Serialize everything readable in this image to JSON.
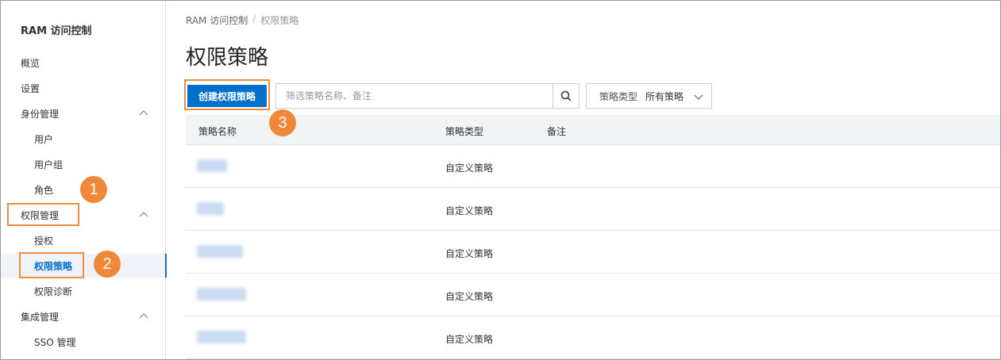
{
  "sidebar": {
    "title": "RAM 访问控制",
    "items": [
      {
        "label": "概览",
        "level": 0
      },
      {
        "label": "设置",
        "level": 0
      },
      {
        "label": "身份管理",
        "level": 0,
        "expandable": true
      },
      {
        "label": "用户",
        "level": 1
      },
      {
        "label": "用户组",
        "level": 1
      },
      {
        "label": "角色",
        "level": 1
      },
      {
        "label": "权限管理",
        "level": 0,
        "expandable": true
      },
      {
        "label": "授权",
        "level": 1
      },
      {
        "label": "权限策略",
        "level": 1,
        "active": true
      },
      {
        "label": "权限诊断",
        "level": 1
      },
      {
        "label": "集成管理",
        "level": 0,
        "expandable": true
      },
      {
        "label": "SSO 管理",
        "level": 1
      }
    ]
  },
  "breadcrumb": {
    "root": "RAM 访问控制",
    "separator": "/",
    "current": "权限策略"
  },
  "page_title": "权限策略",
  "toolbar": {
    "create_label": "创建权限策略",
    "search_placeholder": "筛选策略名称、备注",
    "filter_label": "策略类型",
    "filter_value": "所有策略"
  },
  "table": {
    "columns": [
      "策略名称",
      "策略类型",
      "备注"
    ],
    "rows": [
      {
        "type": "自定义策略"
      },
      {
        "type": "自定义策略"
      },
      {
        "type": "自定义策略"
      },
      {
        "type": "自定义策略"
      },
      {
        "type": "自定义策略"
      }
    ]
  },
  "annotations": [
    "1",
    "2",
    "3"
  ],
  "colors": {
    "accent": "#0070cc",
    "annotation": "#f08c3c",
    "header_bg": "#f2f3f5"
  }
}
